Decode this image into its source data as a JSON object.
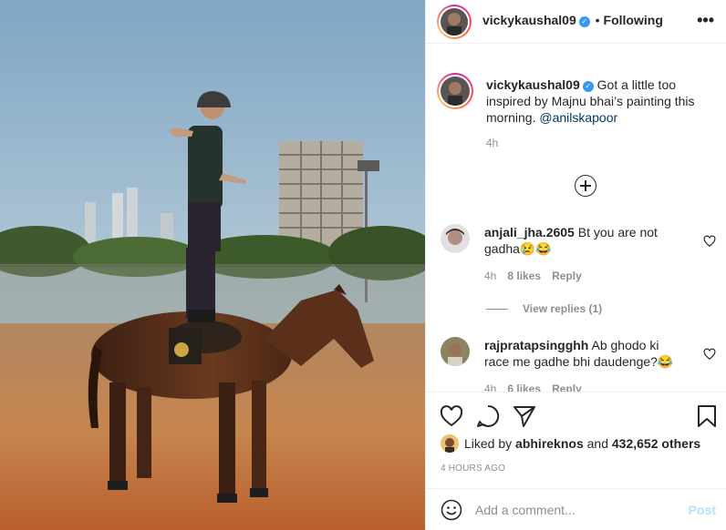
{
  "post_author": {
    "username": "vickykaushal09",
    "verified": true,
    "separator": "•",
    "follow_status": "Following",
    "avatar_icon": "profile-photo"
  },
  "header": {
    "more_icon": "more-options-icon",
    "more_label": "•••"
  },
  "caption": {
    "username": "vickykaushal09",
    "text": "Got a little too inspired by Majnu bhai’s painting this morning.",
    "mention": "@anilskapoor",
    "time": "4h"
  },
  "load_more_icon": "plus-circle-icon",
  "comments": [
    {
      "username": "anjali_jha.2605",
      "text": "Bt you are not gadha😢😂",
      "time": "4h",
      "likes": "8 likes",
      "reply_label": "Reply",
      "view_replies": "View replies (1)"
    },
    {
      "username": "rajpratapsingghh",
      "text": "Ab ghodo ki race me gadhe bhi daudenge?😂",
      "time": "4h",
      "likes": "6 likes",
      "reply_label": "Reply"
    }
  ],
  "actions": {
    "icons": [
      "heart-icon",
      "comment-icon",
      "share-icon",
      "bookmark-icon"
    ]
  },
  "likes": {
    "prefix": "Liked by",
    "user": "abhireknos",
    "conjunction": "and",
    "others": "432,652 others"
  },
  "post_time": "4 HOURS AGO",
  "add_comment": {
    "placeholder": "Add a comment...",
    "post_label": "Post"
  },
  "colors": {
    "link": "#00376b",
    "verified": "#3897f0",
    "muted": "#8e8e8e",
    "post_disabled": "#b2dffc"
  }
}
